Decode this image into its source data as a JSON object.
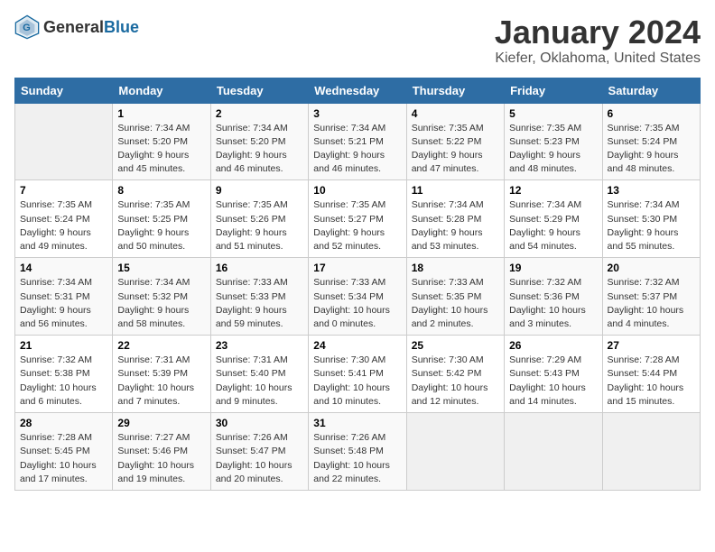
{
  "header": {
    "logo_general": "General",
    "logo_blue": "Blue",
    "title": "January 2024",
    "subtitle": "Kiefer, Oklahoma, United States"
  },
  "days_of_week": [
    "Sunday",
    "Monday",
    "Tuesday",
    "Wednesday",
    "Thursday",
    "Friday",
    "Saturday"
  ],
  "weeks": [
    [
      {
        "num": "",
        "info": ""
      },
      {
        "num": "1",
        "info": "Sunrise: 7:34 AM\nSunset: 5:20 PM\nDaylight: 9 hours\nand 45 minutes."
      },
      {
        "num": "2",
        "info": "Sunrise: 7:34 AM\nSunset: 5:20 PM\nDaylight: 9 hours\nand 46 minutes."
      },
      {
        "num": "3",
        "info": "Sunrise: 7:34 AM\nSunset: 5:21 PM\nDaylight: 9 hours\nand 46 minutes."
      },
      {
        "num": "4",
        "info": "Sunrise: 7:35 AM\nSunset: 5:22 PM\nDaylight: 9 hours\nand 47 minutes."
      },
      {
        "num": "5",
        "info": "Sunrise: 7:35 AM\nSunset: 5:23 PM\nDaylight: 9 hours\nand 48 minutes."
      },
      {
        "num": "6",
        "info": "Sunrise: 7:35 AM\nSunset: 5:24 PM\nDaylight: 9 hours\nand 48 minutes."
      }
    ],
    [
      {
        "num": "7",
        "info": "Sunrise: 7:35 AM\nSunset: 5:24 PM\nDaylight: 9 hours\nand 49 minutes."
      },
      {
        "num": "8",
        "info": "Sunrise: 7:35 AM\nSunset: 5:25 PM\nDaylight: 9 hours\nand 50 minutes."
      },
      {
        "num": "9",
        "info": "Sunrise: 7:35 AM\nSunset: 5:26 PM\nDaylight: 9 hours\nand 51 minutes."
      },
      {
        "num": "10",
        "info": "Sunrise: 7:35 AM\nSunset: 5:27 PM\nDaylight: 9 hours\nand 52 minutes."
      },
      {
        "num": "11",
        "info": "Sunrise: 7:34 AM\nSunset: 5:28 PM\nDaylight: 9 hours\nand 53 minutes."
      },
      {
        "num": "12",
        "info": "Sunrise: 7:34 AM\nSunset: 5:29 PM\nDaylight: 9 hours\nand 54 minutes."
      },
      {
        "num": "13",
        "info": "Sunrise: 7:34 AM\nSunset: 5:30 PM\nDaylight: 9 hours\nand 55 minutes."
      }
    ],
    [
      {
        "num": "14",
        "info": "Sunrise: 7:34 AM\nSunset: 5:31 PM\nDaylight: 9 hours\nand 56 minutes."
      },
      {
        "num": "15",
        "info": "Sunrise: 7:34 AM\nSunset: 5:32 PM\nDaylight: 9 hours\nand 58 minutes."
      },
      {
        "num": "16",
        "info": "Sunrise: 7:33 AM\nSunset: 5:33 PM\nDaylight: 9 hours\nand 59 minutes."
      },
      {
        "num": "17",
        "info": "Sunrise: 7:33 AM\nSunset: 5:34 PM\nDaylight: 10 hours\nand 0 minutes."
      },
      {
        "num": "18",
        "info": "Sunrise: 7:33 AM\nSunset: 5:35 PM\nDaylight: 10 hours\nand 2 minutes."
      },
      {
        "num": "19",
        "info": "Sunrise: 7:32 AM\nSunset: 5:36 PM\nDaylight: 10 hours\nand 3 minutes."
      },
      {
        "num": "20",
        "info": "Sunrise: 7:32 AM\nSunset: 5:37 PM\nDaylight: 10 hours\nand 4 minutes."
      }
    ],
    [
      {
        "num": "21",
        "info": "Sunrise: 7:32 AM\nSunset: 5:38 PM\nDaylight: 10 hours\nand 6 minutes."
      },
      {
        "num": "22",
        "info": "Sunrise: 7:31 AM\nSunset: 5:39 PM\nDaylight: 10 hours\nand 7 minutes."
      },
      {
        "num": "23",
        "info": "Sunrise: 7:31 AM\nSunset: 5:40 PM\nDaylight: 10 hours\nand 9 minutes."
      },
      {
        "num": "24",
        "info": "Sunrise: 7:30 AM\nSunset: 5:41 PM\nDaylight: 10 hours\nand 10 minutes."
      },
      {
        "num": "25",
        "info": "Sunrise: 7:30 AM\nSunset: 5:42 PM\nDaylight: 10 hours\nand 12 minutes."
      },
      {
        "num": "26",
        "info": "Sunrise: 7:29 AM\nSunset: 5:43 PM\nDaylight: 10 hours\nand 14 minutes."
      },
      {
        "num": "27",
        "info": "Sunrise: 7:28 AM\nSunset: 5:44 PM\nDaylight: 10 hours\nand 15 minutes."
      }
    ],
    [
      {
        "num": "28",
        "info": "Sunrise: 7:28 AM\nSunset: 5:45 PM\nDaylight: 10 hours\nand 17 minutes."
      },
      {
        "num": "29",
        "info": "Sunrise: 7:27 AM\nSunset: 5:46 PM\nDaylight: 10 hours\nand 19 minutes."
      },
      {
        "num": "30",
        "info": "Sunrise: 7:26 AM\nSunset: 5:47 PM\nDaylight: 10 hours\nand 20 minutes."
      },
      {
        "num": "31",
        "info": "Sunrise: 7:26 AM\nSunset: 5:48 PM\nDaylight: 10 hours\nand 22 minutes."
      },
      {
        "num": "",
        "info": ""
      },
      {
        "num": "",
        "info": ""
      },
      {
        "num": "",
        "info": ""
      }
    ]
  ]
}
